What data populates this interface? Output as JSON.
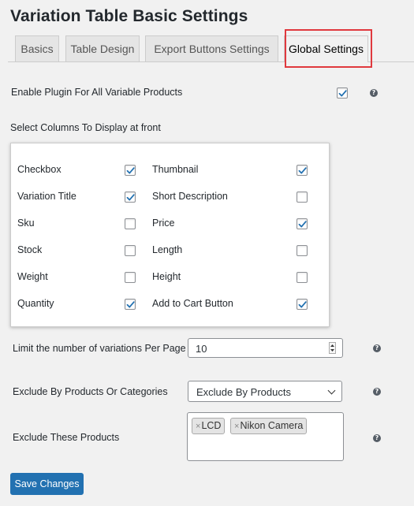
{
  "page": {
    "title": "Variation Table Basic Settings"
  },
  "tabs": [
    {
      "label": "Basics"
    },
    {
      "label": "Table Design"
    },
    {
      "label": "Export Buttons Settings"
    },
    {
      "label": "Global Settings"
    }
  ],
  "enable_all": {
    "label": "Enable Plugin For All Variable Products",
    "checked": true
  },
  "columns_section": {
    "label": "Select Columns To Display at front"
  },
  "columns": [
    {
      "label": "Checkbox",
      "checked": true
    },
    {
      "label": "Thumbnail",
      "checked": true
    },
    {
      "label": "Variation Title",
      "checked": true
    },
    {
      "label": "Short Description",
      "checked": false
    },
    {
      "label": "Sku",
      "checked": false
    },
    {
      "label": "Price",
      "checked": true
    },
    {
      "label": "Stock",
      "checked": false
    },
    {
      "label": "Length",
      "checked": false
    },
    {
      "label": "Weight",
      "checked": false
    },
    {
      "label": "Height",
      "checked": false
    },
    {
      "label": "Quantity",
      "checked": true
    },
    {
      "label": "Add to Cart Button",
      "checked": true
    }
  ],
  "limit": {
    "label": "Limit the number of variations Per Page",
    "value": "10"
  },
  "exclude_by": {
    "label": "Exclude By Products Or Categories",
    "selected": "Exclude By Products"
  },
  "exclude_products": {
    "label": "Exclude These Products",
    "chips": [
      "LCD",
      "Nikon Camera"
    ],
    "remove_glyph": "×"
  },
  "help_glyph": "?",
  "save": {
    "label": "Save Changes"
  },
  "colors": {
    "accent": "#2271b1",
    "highlight": "#e0393e",
    "background": "#f1f1f1"
  },
  "icons": {
    "checkmark": "checkmark-icon",
    "help": "help-icon",
    "spinner": "spinner-arrows-icon",
    "dropdown": "chevron-down-icon"
  }
}
